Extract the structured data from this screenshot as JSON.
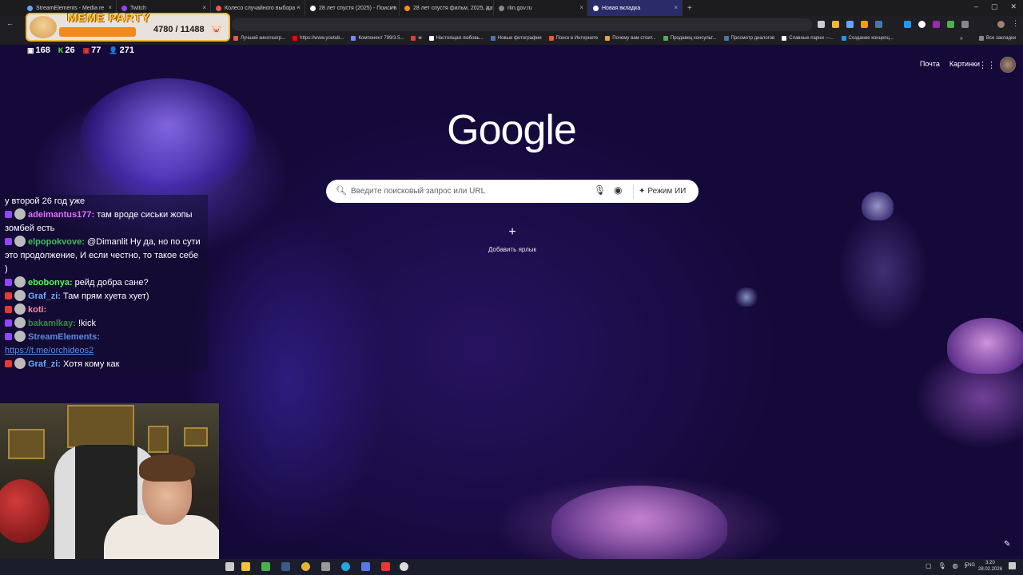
{
  "browser": {
    "tabs": [
      {
        "label": "StreamElements - Media re",
        "color": "#6aa3ff"
      },
      {
        "label": "Twitch",
        "color": "#9146ff"
      },
      {
        "label": "Колесо случайного выбора -",
        "color": "#e85a4f"
      },
      {
        "label": "28 лет спустя (2025) - Поиск в",
        "color": "#ffffff"
      },
      {
        "label": "28 лет спустя фильм, 2025, дат",
        "color": "#f28b24"
      },
      {
        "label": "rkn.gov.ru",
        "color": "#888888"
      },
      {
        "label": "Новая вкладка",
        "color": "#ffffff"
      }
    ],
    "new_tab_symbol": "+",
    "bookmarks": [
      {
        "label": "Лучший кинотеатр...",
        "color": "#e85a4f"
      },
      {
        "label": "https://www.youtub...",
        "color": "#ff0000"
      },
      {
        "label": "Компонент 799/3.5...",
        "color": "#6a8cff"
      },
      {
        "label": "м",
        "color": "#e53935"
      },
      {
        "label": "Настоящая любовь...",
        "color": "#ffffff"
      },
      {
        "label": "Новые фотографии",
        "color": "#4a76a8"
      },
      {
        "label": "Поиск в Интернете",
        "color": "#ff5722"
      },
      {
        "label": "Почему вам стоит...",
        "color": "#e8a33a"
      },
      {
        "label": "Продавец консульт...",
        "color": "#4caf50"
      },
      {
        "label": "Просмотр диалогов",
        "color": "#4a76a8"
      },
      {
        "label": "Славные парни ---...",
        "color": "#ffffff"
      },
      {
        "label": "Создание концепц...",
        "color": "#2196f3"
      }
    ],
    "all_bookmarks": "Все закладки"
  },
  "meme_widget": {
    "title": "MEME PARTY",
    "score": "4780 / 11488",
    "pig_icon": "pig-icon"
  },
  "stream_stats": {
    "chat": "168",
    "kick": "26",
    "live": "77",
    "viewers": "271"
  },
  "google": {
    "mail": "Почта",
    "images": "Картинки",
    "logo": "Google",
    "search_placeholder": "Введите поисковый запрос или URL",
    "ai_mode": "Режим ИИ",
    "add_shortcut_symbol": "+",
    "add_shortcut": "Добавить ярлык"
  },
  "chat": [
    {
      "name": "",
      "text": "у второй 26 год уже",
      "name_color": "#ffffff",
      "platform": "none"
    },
    {
      "name": "adeimantus177:",
      "text": " там вроде сиськи жопы зомбей есть",
      "name_color": "#e070ff",
      "platform": "twitch"
    },
    {
      "name": "elpopokvove:",
      "text": " @Dimanlit Ну да, но по сути это продолжение, И если честно, то такое себе )",
      "name_color": "#3fbf5a",
      "platform": "twitch"
    },
    {
      "name": "ebobonya:",
      "text": " рейд добра сане?",
      "name_color": "#4cff4c",
      "platform": "twitch"
    },
    {
      "name": "Graf_zi:",
      "text": " Там прям хуета хует)",
      "name_color": "#6ab0ff",
      "platform": "live"
    },
    {
      "name": "koti:",
      "text": "",
      "name_color": "#ff8aa0",
      "platform": "live"
    },
    {
      "name": "bakamlkay:",
      "text": " !kick",
      "name_color": "#3a8a40",
      "platform": "twitch"
    },
    {
      "name": "StreamElements:",
      "text": "",
      "name_color": "#5a8be6",
      "platform": "twitch"
    },
    {
      "name": "",
      "text": "https://t.me/orchideos2",
      "name_color": "#5a8be6",
      "platform": "link"
    },
    {
      "name": "Graf_zi:",
      "text": " Хотя кому как",
      "name_color": "#6ab0ff",
      "platform": "live"
    }
  ],
  "taskbar": {
    "lang": "ENG",
    "time": "3:20",
    "date": "28.02.2026"
  }
}
